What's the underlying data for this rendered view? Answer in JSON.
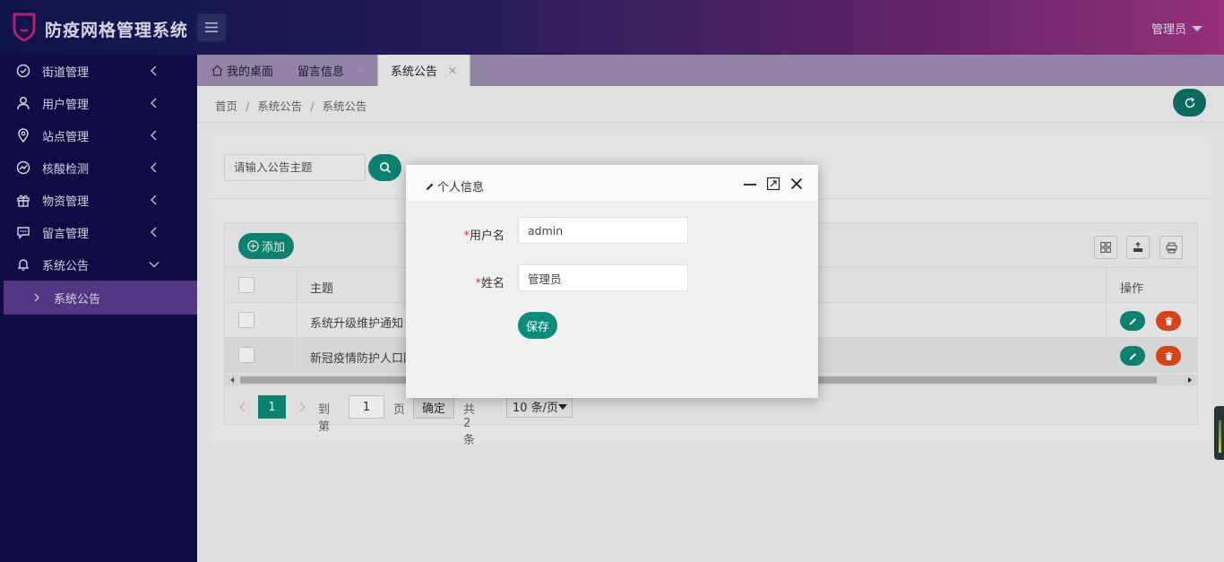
{
  "app": {
    "title": "防疫网格管理系统",
    "user": "管理员"
  },
  "sidebar": {
    "items": [
      {
        "label": "街道管理",
        "icon": "check-circle-icon"
      },
      {
        "label": "用户管理",
        "icon": "user-icon"
      },
      {
        "label": "站点管理",
        "icon": "location-icon"
      },
      {
        "label": "核酸检测",
        "icon": "trend-icon"
      },
      {
        "label": "物资管理",
        "icon": "gift-icon"
      },
      {
        "label": "留言管理",
        "icon": "message-icon"
      },
      {
        "label": "系统公告",
        "icon": "bell-icon"
      }
    ],
    "sub_item": "系统公告"
  },
  "tabs": [
    {
      "label": "我的桌面"
    },
    {
      "label": "留言信息",
      "close": "✕"
    },
    {
      "label": "系统公告",
      "close": "✕"
    }
  ],
  "breadcrumb": [
    "首页",
    "系统公告",
    "系统公告"
  ],
  "search": {
    "placeholder": "请输入公告主题"
  },
  "toolbar": {
    "add_label": "添加"
  },
  "table": {
    "headers": {
      "subject": "主题",
      "ops": "操作"
    },
    "rows": [
      {
        "subject": "系统升级维护通知"
      },
      {
        "subject": "新冠疫情防护人口网"
      }
    ]
  },
  "pager": {
    "current": "1",
    "goto": "到第",
    "page_input": "1",
    "page_unit": "页",
    "confirm": "确定",
    "total": "共 2 条",
    "page_size": "10 条/页"
  },
  "modal": {
    "title": "个人信息",
    "fields": [
      {
        "required": "*",
        "label": "用户名",
        "value": "admin"
      },
      {
        "required": "*",
        "label": "姓名",
        "value": "管理员"
      }
    ],
    "save_label": "保存"
  },
  "colors": {
    "primary": "#0c8d7b",
    "danger": "#e64a19",
    "sidebar": "#100c4b"
  }
}
